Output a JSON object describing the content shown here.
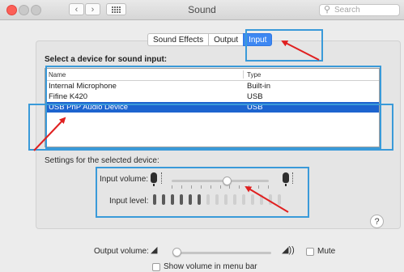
{
  "window": {
    "title": "Sound",
    "search_placeholder": "Search"
  },
  "tabs": [
    {
      "label": "Sound Effects",
      "selected": false
    },
    {
      "label": "Output",
      "selected": false
    },
    {
      "label": "Input",
      "selected": true
    }
  ],
  "input_section": {
    "title": "Select a device for sound input:",
    "columns": [
      "Name",
      "Type"
    ],
    "rows": [
      {
        "name": "Internal Microphone",
        "type": "Built-in",
        "selected": false
      },
      {
        "name": "Fifine K420",
        "type": "USB",
        "selected": false
      },
      {
        "name": "USB PnP Audio Device",
        "type": "USB",
        "selected": true
      }
    ]
  },
  "settings": {
    "title": "Settings for the selected device:",
    "input_volume_label": "Input volume:",
    "input_volume_fraction": 0.57,
    "input_level_label": "Input level:",
    "input_level_segments_active": 6,
    "input_level_segments_total": 15
  },
  "output": {
    "volume_label": "Output volume:",
    "volume_fraction": 0.0,
    "mute_label": "Mute",
    "mute_checked": false,
    "menu_bar_label": "Show volume in menu bar",
    "menu_bar_checked": false
  },
  "help_label": "?",
  "colors": {
    "highlight": "#1d64cf",
    "annotation_box": "#3a9ad9",
    "annotation_arrow": "#e02020",
    "tab_active": "#3d87f2"
  },
  "icons": [
    "close-light",
    "minimize-light",
    "zoom-light",
    "back-chevron-icon",
    "forward-chevron-icon",
    "grid-icon",
    "search-icon",
    "microphone-icon",
    "speaker-icon",
    "help-icon"
  ]
}
